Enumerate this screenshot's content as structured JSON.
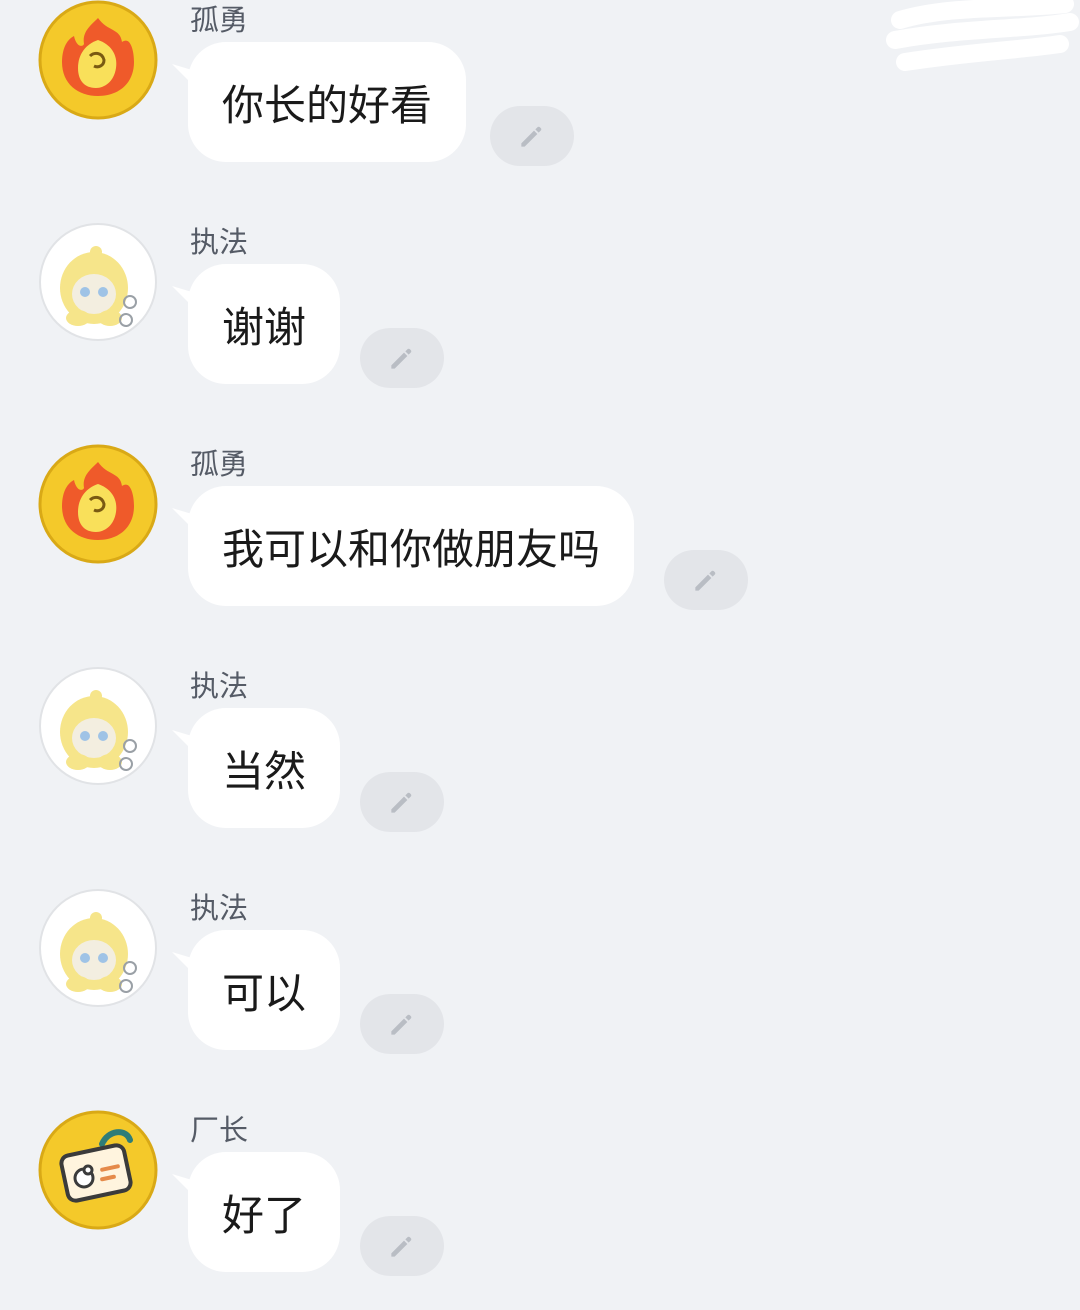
{
  "messages": [
    {
      "sender": "孤勇",
      "avatar": "flame-avatar",
      "text": "你长的好看"
    },
    {
      "sender": "执法",
      "avatar": "yellow-hood-character-avatar",
      "text": "谢谢"
    },
    {
      "sender": "孤勇",
      "avatar": "flame-avatar",
      "text": "我可以和你做朋友吗"
    },
    {
      "sender": "执法",
      "avatar": "yellow-hood-character-avatar",
      "text": "当然"
    },
    {
      "sender": "执法",
      "avatar": "yellow-hood-character-avatar",
      "text": "可以"
    },
    {
      "sender": "厂长",
      "avatar": "id-badge-avatar",
      "text": "好了"
    }
  ],
  "icons": {
    "edit": "pencil-icon"
  },
  "colors": {
    "background": "#f0f2f5",
    "bubble": "#ffffff",
    "edit_button": "#e3e5e9",
    "avatar_yellow": "#f4c92a"
  }
}
